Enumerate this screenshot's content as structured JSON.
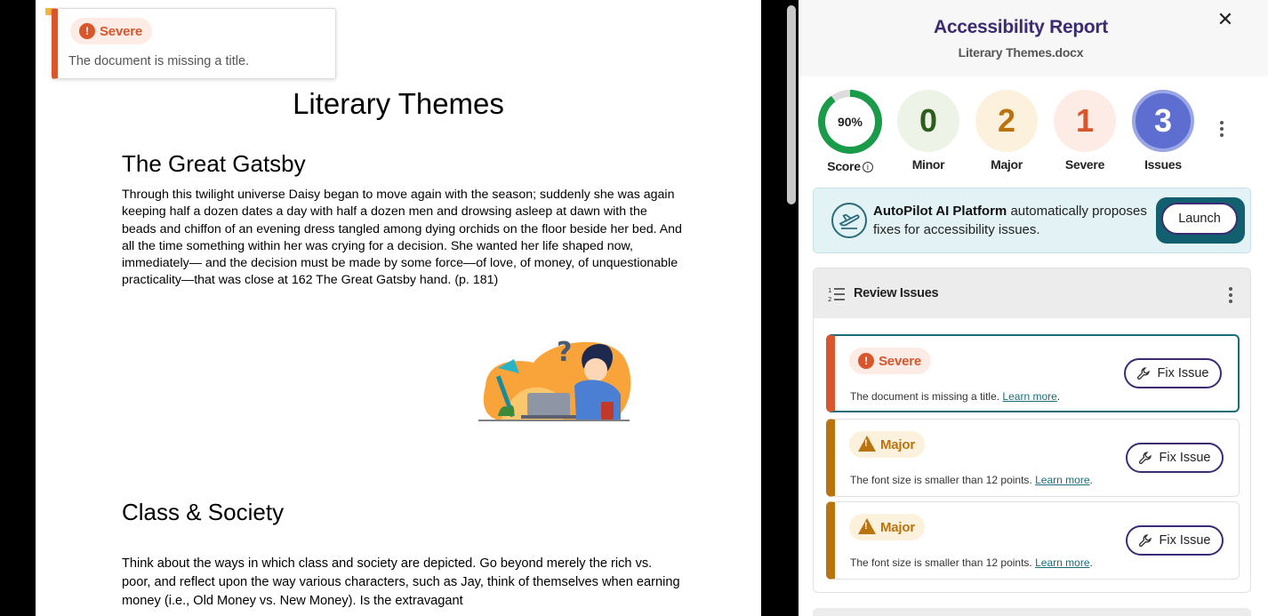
{
  "document": {
    "tooltip": {
      "badge": "Severe",
      "message": "The document is missing a title."
    },
    "title": "Literary Themes",
    "sections": [
      {
        "heading": "The Great Gatsby",
        "body": "Through this twilight universe Daisy began to move again with the season; suddenly she was again keeping half a dozen dates a day with half a dozen men and drowsing asleep at dawn with the beads and chiffon of an evening dress tangled among dying orchids on the floor beside her bed. And all the time something within her was crying for a decision. She wanted her life shaped now, immediately— and the decision must be made by some force—of love, of money, of unquestionable practicality—that was close at 162 The Great Gatsby hand. (p. 181)"
      },
      {
        "heading": "Class & Society",
        "body": "Think about the ways in which class and society are depicted. Go beyond merely the rich vs. poor, and reflect upon the way various characters, such as Jay, think of themselves when earning money (i.e., Old Money vs. New Money). Is the extravagant"
      }
    ]
  },
  "report": {
    "title": "Accessibility Report",
    "filename": "Literary Themes.docx",
    "close_symbol": "✕",
    "stats": {
      "score": {
        "value": "90%",
        "label": "Score",
        "fraction": 0.9
      },
      "minor": {
        "value": "0",
        "label": "Minor"
      },
      "major": {
        "value": "2",
        "label": "Major"
      },
      "severe": {
        "value": "1",
        "label": "Severe"
      },
      "issues": {
        "value": "3",
        "label": "Issues"
      }
    },
    "autopilot": {
      "brand": "AutoPilot AI Platform",
      "text": " automatically proposes fixes for accessibility issues.",
      "launch_label": "Launch"
    },
    "review": {
      "title": "Review Issues",
      "learn_more": "Learn more",
      "fix_label": "Fix Issue",
      "issues": [
        {
          "severity": "Severe",
          "description": "The document is missing a title."
        },
        {
          "severity": "Major",
          "description": "The font size is smaller than 12 points."
        },
        {
          "severity": "Major",
          "description": "The font size is smaller than 12 points."
        }
      ]
    },
    "colors": {
      "severe": "#d9552b",
      "major": "#b9740f",
      "minor": "#2f5d1e",
      "issues": "#5d6ed0",
      "score": "#1a9b4a",
      "title": "#3c2a72",
      "teal": "#12606f"
    }
  }
}
